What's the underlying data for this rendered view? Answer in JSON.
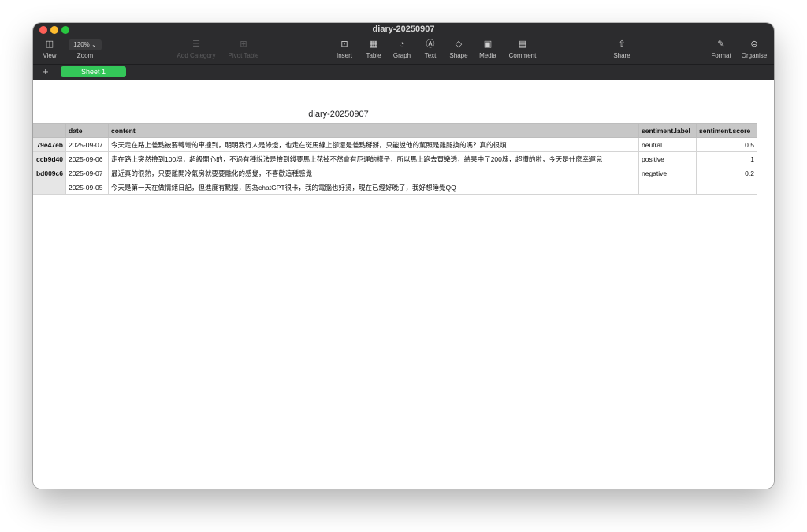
{
  "window": {
    "title": "diary-20250907"
  },
  "toolbar": {
    "view": "View",
    "zoom_value": "120% ⌄",
    "zoom": "Zoom",
    "add_category": "Add Category",
    "pivot_table": "Pivot Table",
    "insert": "Insert",
    "table": "Table",
    "graph": "Graph",
    "text": "Text",
    "shape": "Shape",
    "media": "Media",
    "comment": "Comment",
    "share": "Share",
    "format": "Format",
    "organise": "Organise"
  },
  "sheets": {
    "add": "+",
    "tabs": [
      "Sheet 1"
    ]
  },
  "table": {
    "title": "diary-20250907",
    "columns": [
      "",
      "date",
      "content",
      "sentiment.label",
      "sentiment.score"
    ],
    "rows": [
      [
        "79e47eb",
        "2025-09-07",
        "今天走在路上差點被要轉彎的車撞到，明明我行人是綠燈，也走在斑馬線上卻還是差點掰掰，只能說他的駕照是雞腿換的嗎？真的很煩",
        "neutral",
        "0.5"
      ],
      [
        "ccb9d40",
        "2025-09-06",
        "走在路上突然撿到100塊，超級開心的，不過有種說法是撿到錢要馬上花掉不然會有厄運的樣子，所以馬上跑去買樂透，結果中了200塊，超讚的啦，今天是什麼幸運兒！",
        "positive",
        "1"
      ],
      [
        "bd009c6",
        "2025-09-07",
        "最近真的很熱，只要離開冷氣房就要要融化的感覺，不喜歡這種感覺",
        "negative",
        "0.2"
      ],
      [
        "",
        "2025-09-05",
        "今天是第一天在做情緒日記，但進度有點慢，因為chatGPT很卡，我的電腦也好燙，現在已經好晚了，我好想睡覺QQ",
        "",
        ""
      ]
    ]
  }
}
